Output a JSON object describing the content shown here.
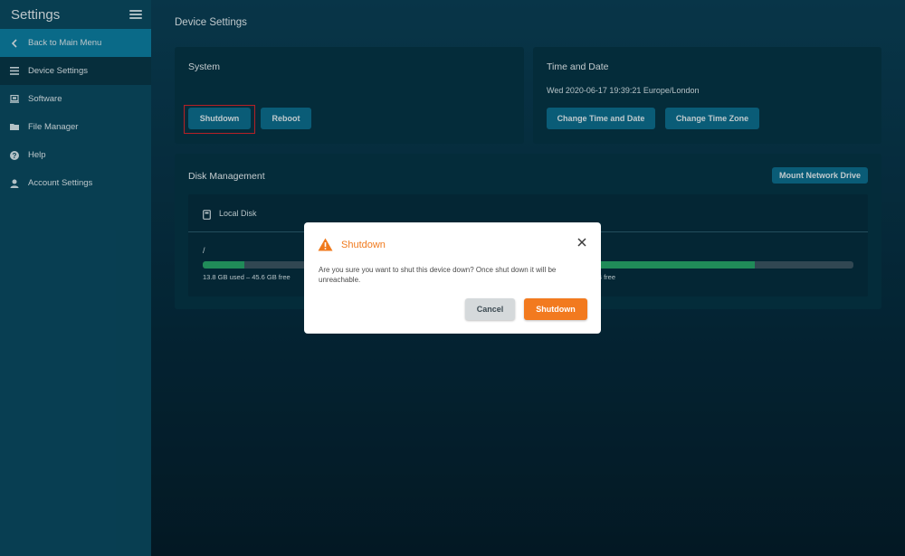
{
  "sidebar": {
    "title": "Settings",
    "items": [
      {
        "label": "Back to Main Menu",
        "icon": "chevron-left-icon"
      },
      {
        "label": "Device Settings",
        "icon": "list-icon"
      },
      {
        "label": "Software",
        "icon": "software-icon"
      },
      {
        "label": "File Manager",
        "icon": "folder-icon"
      },
      {
        "label": "Help",
        "icon": "help-icon"
      },
      {
        "label": "Account Settings",
        "icon": "user-icon"
      }
    ]
  },
  "page": {
    "title": "Device Settings"
  },
  "system": {
    "title": "System",
    "shutdown_label": "Shutdown",
    "reboot_label": "Reboot"
  },
  "time_date": {
    "title": "Time and Date",
    "current": "Wed 2020-06-17 19:39:21 Europe/London",
    "change_time_label": "Change Time and Date",
    "change_zone_label": "Change Time Zone"
  },
  "disk": {
    "title": "Disk Management",
    "mount_label": "Mount Network Drive",
    "local_disk_label": "Local Disk",
    "partitions": [
      {
        "mount": "/",
        "usage": "13.8 GB used – 45.6 GB free",
        "used_fraction": 0.23
      },
      {
        "mount": "",
        "usage": "B free",
        "used_fraction": 0.7
      }
    ]
  },
  "modal": {
    "title": "Shutdown",
    "message": "Are you sure you want to shut this device down? Once shut down it will be unreachable.",
    "cancel_label": "Cancel",
    "confirm_label": "Shutdown"
  },
  "colors": {
    "accent": "#0d6e8e",
    "warning": "#f07a1d",
    "disk_fill": "#28a86a",
    "highlight": "#e0252b"
  }
}
